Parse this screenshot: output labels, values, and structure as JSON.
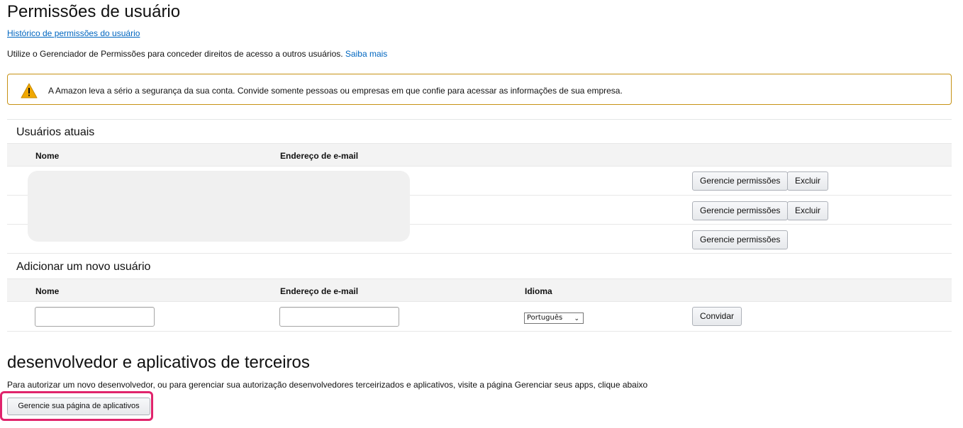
{
  "page": {
    "title": "Permissões de usuário",
    "history_link": "Histórico de permissões do usuário",
    "intro_text": "Utilize o Gerenciador de Permissões para conceder direitos de acesso a outros usuários.",
    "learn_more": "Saiba mais"
  },
  "alert": {
    "icon": "warning-icon",
    "text": "A Amazon leva a sério a segurança da sua conta. Convide somente pessoas ou empresas em que confie para acessar as informações de sua empresa.",
    "color": "#c69214"
  },
  "current_users": {
    "heading": "Usuários atuais",
    "columns": [
      "Nome",
      "Endereço de e-mail"
    ],
    "rows": [
      {
        "manage_label": "Gerencie permissões",
        "delete_label": "Excluir"
      },
      {
        "manage_label": "Gerencie permissões",
        "delete_label": "Excluir"
      },
      {
        "manage_label": "Gerencie permissões"
      }
    ]
  },
  "add_user": {
    "heading": "Adicionar um novo usuário",
    "columns": [
      "Nome",
      "Endereço de e-mail",
      "Idioma"
    ],
    "name_value": "",
    "email_value": "",
    "language_selected": "Português",
    "invite_label": "Convidar"
  },
  "developer": {
    "heading": "desenvolvedor e aplicativos de terceiros",
    "description": "Para autorizar um novo desenvolvedor, ou para gerenciar sua autorização desenvolvedores terceirizados e aplicativos, visite a página Gerenciar seus apps, clique abaixo",
    "button_label": "Gerencie sua página de aplicativos",
    "highlight_color": "#e0246c"
  }
}
